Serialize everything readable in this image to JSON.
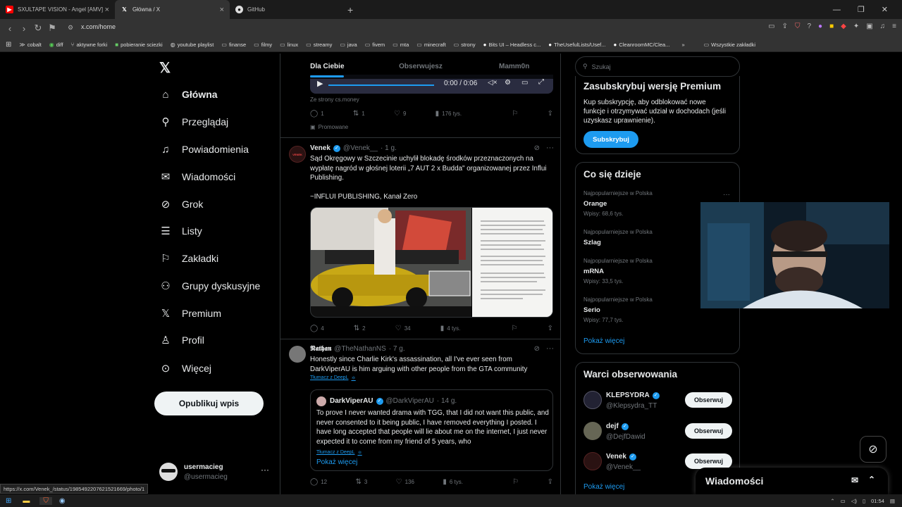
{
  "browser": {
    "tabs": [
      {
        "title": "SXULTAPE VISION - Angel [AMV]",
        "icon": "youtube-icon",
        "color": "#ff0000"
      },
      {
        "title": "Główna / X",
        "icon": "x-logo-icon"
      },
      {
        "title": "GitHub",
        "icon": "github-icon"
      }
    ],
    "new_tab": "+",
    "url": "x.com/home",
    "bookmarks": [
      {
        "label": "cobalt",
        "icon": "cobalt-icon"
      },
      {
        "label": "diff",
        "icon": "diff-icon"
      },
      {
        "label": "aktywne forki",
        "icon": "fork-icon"
      },
      {
        "label": "pobieranie sciezki",
        "icon": "download-icon"
      },
      {
        "label": "youtube playlist",
        "icon": "globe-icon"
      },
      {
        "label": "finanse",
        "icon": "folder-icon"
      },
      {
        "label": "filmy",
        "icon": "folder-icon"
      },
      {
        "label": "linux",
        "icon": "folder-icon"
      },
      {
        "label": "streamy",
        "icon": "folder-icon"
      },
      {
        "label": "java",
        "icon": "folder-icon"
      },
      {
        "label": "fivem",
        "icon": "folder-icon"
      },
      {
        "label": "mta",
        "icon": "folder-icon"
      },
      {
        "label": "minecraft",
        "icon": "folder-icon"
      },
      {
        "label": "strony",
        "icon": "folder-icon"
      },
      {
        "label": "Bits UI – Headless c...",
        "icon": "circle-icon"
      },
      {
        "label": "TheUsefulLists/Usef...",
        "icon": "github-icon"
      },
      {
        "label": "CleanroomMC/Clea...",
        "icon": "github-icon"
      }
    ],
    "bookmarks_more": "»",
    "other_bookmarks": "Wszystkie zakładki",
    "status_url": "https://x.com/Venek_/status/1985492207621521669/photo/1"
  },
  "nav": {
    "items": [
      {
        "label": "Główna",
        "icon": "home-icon",
        "active": true
      },
      {
        "label": "Przeglądaj",
        "icon": "search-icon"
      },
      {
        "label": "Powiadomienia",
        "icon": "bell-icon"
      },
      {
        "label": "Wiadomości",
        "icon": "mail-icon"
      },
      {
        "label": "Grok",
        "icon": "grok-icon"
      },
      {
        "label": "Listy",
        "icon": "list-icon"
      },
      {
        "label": "Zakładki",
        "icon": "bookmark-icon"
      },
      {
        "label": "Grupy dyskusyjne",
        "icon": "people-icon"
      },
      {
        "label": "Premium",
        "icon": "x-logo-icon"
      },
      {
        "label": "Profil",
        "icon": "person-icon"
      },
      {
        "label": "Więcej",
        "icon": "more-circle-icon"
      }
    ],
    "post_button": "Opublikuj wpis",
    "user": {
      "name": "usermacieg",
      "handle": "@usermacieg"
    }
  },
  "feed": {
    "tabs": [
      "Dla Ciebie",
      "Obserwujesz",
      "Mamm0n"
    ],
    "ad_post": {
      "video_time": "0:00 / 0:06",
      "source": "Ze strony cs.money",
      "stats": {
        "replies": "1",
        "reposts": "1",
        "likes": "9",
        "views": "176 tys."
      },
      "promoted": "Promowane"
    },
    "post1": {
      "name": "Venek",
      "handle": "@Venek__",
      "time": "· 1 g.",
      "avatar_text": "VENEK",
      "text_1": "Sąd Okręgowy w Szczecinie uchylił blokadę środków przeznaczonych na wypłatę nagród w głośnej loterii „7 AUT 2 x Budda\" organizowanej przez Influi Publishing.",
      "text_2": "~INFLUI PUBLISHING, Kanał Zero",
      "stats": {
        "replies": "4",
        "reposts": "2",
        "likes": "34",
        "views": "4 tys."
      }
    },
    "post2": {
      "name": "𝕹𝖆𝖙𝖍𝖆𝖓",
      "handle": "@TheNathanNS",
      "time": "· 7 g.",
      "text": "Honestly since Charlie Kirk's assassination, all I've ever seen from DarkViperAU is him arguing with other people from the GTA community",
      "translate": "Tłumacz z DeepL",
      "quote": {
        "name": "DarkViperAU",
        "handle": "@DarkViperAU",
        "time": "· 14 g.",
        "text": "To prove I never wanted drama with TGG, that I did not want this public, and never consented to it being public, I have removed everything I posted. I have long accepted that people will lie about me on the internet, I just never expected it to come from my friend of 5 years, who",
        "translate": "Tłumacz z DeepL",
        "show_more": "Pokaż więcej"
      },
      "stats": {
        "replies": "12",
        "reposts": "3",
        "likes": "136",
        "views": "6 tys."
      }
    }
  },
  "right": {
    "search_placeholder": "Szukaj",
    "premium": {
      "title": "Zasubskrybuj wersję Premium",
      "text": "Kup subskrypcję, aby odblokować nowe funkcje i otrzymywać udział w dochodach (jeśli uzyskasz uprawnienie).",
      "button": "Subskrybuj"
    },
    "trends": {
      "title": "Co się dzieje",
      "items": [
        {
          "meta": "Najpopularniejsze w Polska",
          "name": "Orange",
          "count": "Wpisy: 68,6 tys."
        },
        {
          "meta": "Najpopularniejsze w Polska",
          "name": "Szlag",
          "count": ""
        },
        {
          "meta": "Najpopularniejsze w Polska",
          "name": "mRNA",
          "count": "Wpisy: 33,5 tys."
        },
        {
          "meta": "Najpopularniejsze w Polska",
          "name": "Serio",
          "count": "Wpisy: 77,7 tys."
        }
      ],
      "show_more": "Pokaż więcej"
    },
    "follow": {
      "title": "Warci obserwowania",
      "items": [
        {
          "name": "KLEPSYDRA",
          "handle": "@Klepsydra_TT",
          "button": "Obserwuj"
        },
        {
          "name": "dejf",
          "handle": "@DejfDawid",
          "button": "Obserwuj"
        },
        {
          "name": "Venek",
          "handle": "@Venek__",
          "button": "Obserwuj"
        }
      ],
      "show_more": "Pokaż więcej"
    }
  },
  "messages_drawer": {
    "title": "Wiadomości"
  },
  "taskbar": {
    "time": "01:54"
  },
  "colors": {
    "accent": "#1d9bf0",
    "bg": "#000000",
    "border": "#2f3336",
    "muted": "#71767b"
  }
}
